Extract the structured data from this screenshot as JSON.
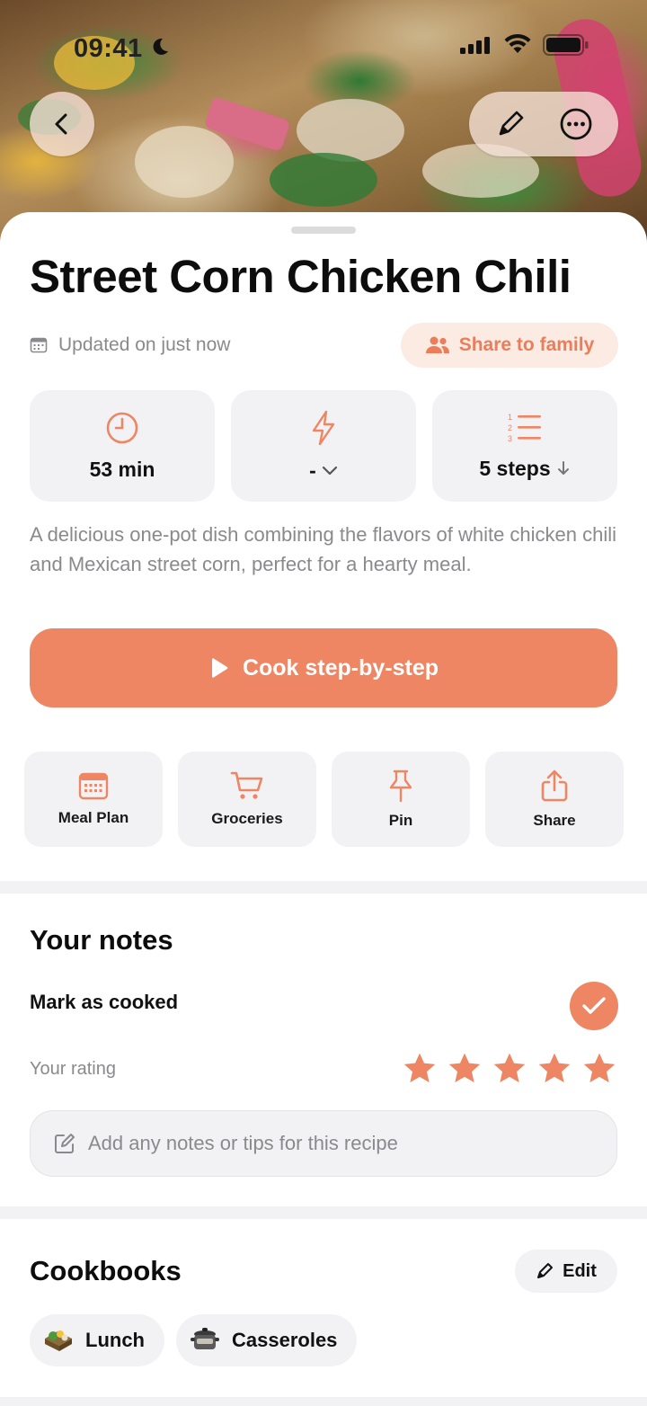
{
  "status_bar": {
    "time": "09:41",
    "icons": [
      "moon-icon",
      "cellular-signal-icon",
      "wifi-icon",
      "battery-icon"
    ]
  },
  "hero": {
    "back_icon": "chevron-left-icon",
    "edit_icon": "pencil-icon",
    "more_icon": "ellipsis-circle-icon"
  },
  "recipe": {
    "title": "Street Corn Chicken Chili",
    "updated": "Updated on just now",
    "share_family_label": "Share to family",
    "stats": [
      {
        "icon": "clock-icon",
        "value": "53 min"
      },
      {
        "icon": "lightning-icon",
        "value": "-"
      },
      {
        "icon": "numbered-list-icon",
        "value": "5 steps"
      }
    ],
    "description": "A delicious one-pot dish combining the flavors of white chicken chili and Mexican street corn, perfect for a hearty meal.",
    "cook_label": "Cook step-by-step"
  },
  "quick_actions": [
    {
      "icon": "calendar-icon",
      "label": "Meal Plan"
    },
    {
      "icon": "cart-icon",
      "label": "Groceries"
    },
    {
      "icon": "pin-icon",
      "label": "Pin"
    },
    {
      "icon": "share-icon",
      "label": "Share"
    }
  ],
  "notes": {
    "title": "Your notes",
    "mark_cooked_label": "Mark as cooked",
    "cooked": true,
    "rating_label": "Your rating",
    "rating": 5,
    "rating_max": 5,
    "notes_placeholder": "Add any notes or tips for this recipe"
  },
  "cookbooks": {
    "title": "Cookbooks",
    "edit_label": "Edit",
    "items": [
      {
        "icon": "lunch-box-icon",
        "label": "Lunch"
      },
      {
        "icon": "casserole-pot-icon",
        "label": "Casseroles"
      }
    ]
  },
  "colors": {
    "accent": "#ee8563",
    "accent_soft": "#fbebe3",
    "card_bg": "#f2f2f5",
    "muted_text": "#8a8a8e"
  }
}
